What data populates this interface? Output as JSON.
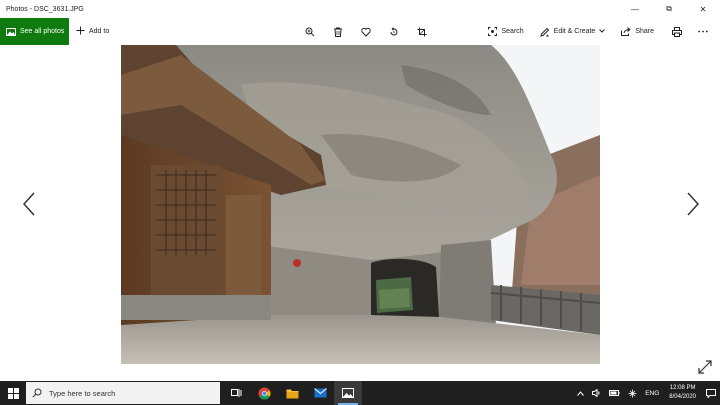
{
  "window": {
    "title": "Photos - DSC_3631.JPG",
    "controls": {
      "minimize": "—",
      "restore": "⧉",
      "close": "✕"
    }
  },
  "toolbar": {
    "see_all_photos": "See all photos",
    "add_to": "Add to",
    "center_icons": [
      "zoom-icon",
      "delete-icon",
      "favorite-icon",
      "rotate-icon",
      "crop-icon"
    ],
    "search": "Search",
    "edit_create": "Edit & Create",
    "share": "Share",
    "print_icon": "print-icon",
    "more_icon": "more-icon",
    "accent": "#0f7b0f"
  },
  "photo": {
    "description_icon": "photo-temple-cave-tunnel"
  },
  "taskbar": {
    "search_placeholder": "Type here to search",
    "apps": [
      "task-view-icon",
      "chrome-icon",
      "file-explorer-icon",
      "mail-icon",
      "photos-icon"
    ],
    "tray": {
      "language": "ENG",
      "time": "12:08 PM",
      "date": "8/04/2020"
    }
  }
}
